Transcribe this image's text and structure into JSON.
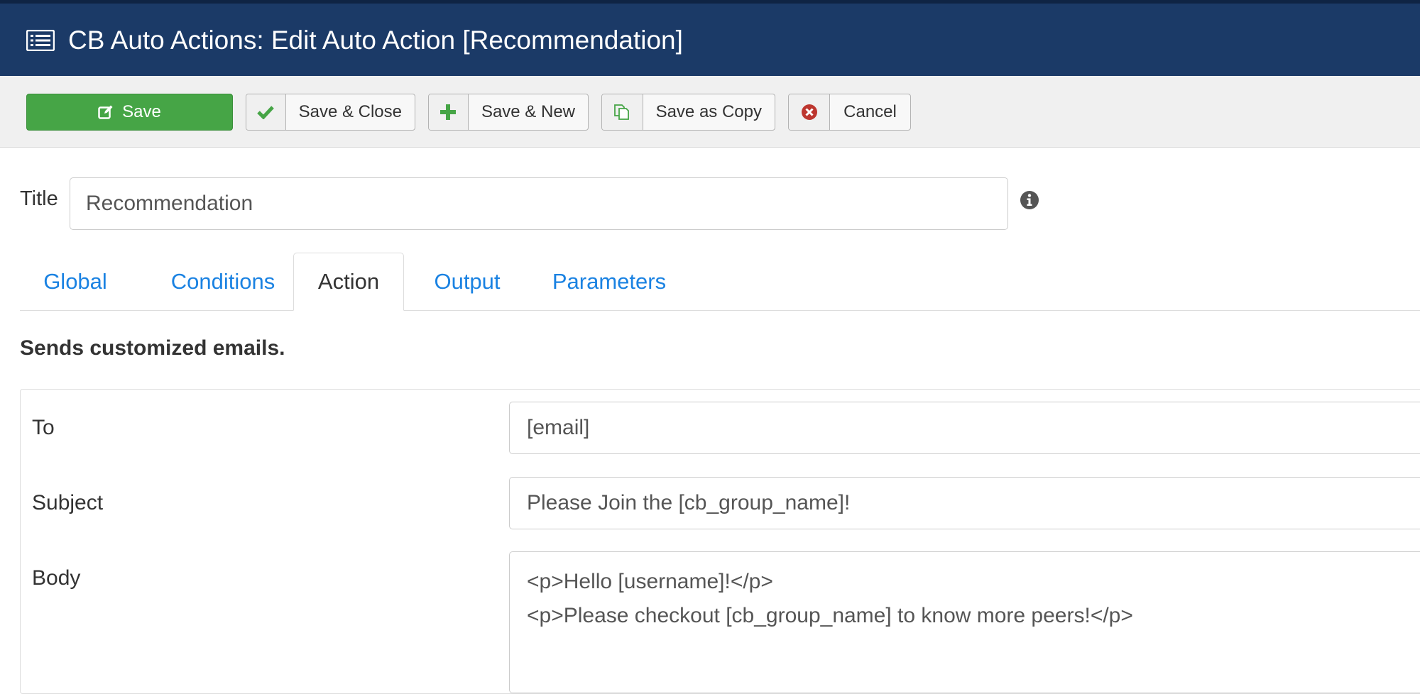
{
  "header": {
    "title": "CB Auto Actions: Edit Auto Action [Recommendation]",
    "icon": "list-icon",
    "background": "#1b3a67"
  },
  "toolbar": {
    "save": {
      "label": "Save",
      "icon": "edit-icon",
      "color": "#46a546"
    },
    "save_close": {
      "label": "Save & Close",
      "icon": "check-icon"
    },
    "save_new": {
      "label": "Save & New",
      "icon": "plus-icon"
    },
    "save_copy": {
      "label": "Save as Copy",
      "icon": "copy-icon"
    },
    "cancel": {
      "label": "Cancel",
      "icon": "cancel-circle-icon"
    }
  },
  "title_field": {
    "label": "Title",
    "value": "Recommendation",
    "info_icon": "info-icon"
  },
  "tabs": [
    {
      "label": "Global",
      "active": false
    },
    {
      "label": "Conditions",
      "active": false
    },
    {
      "label": "Action",
      "active": true
    },
    {
      "label": "Output",
      "active": false
    },
    {
      "label": "Parameters",
      "active": false
    }
  ],
  "description": "Sends customized emails.",
  "fields": {
    "to": {
      "label": "To",
      "value": "[email]"
    },
    "subject": {
      "label": "Subject",
      "value": "Please Join the [cb_group_name]!"
    },
    "body": {
      "label": "Body",
      "value": "<p>Hello [username]!</p>\n<p>Please checkout [cb_group_name] to know more peers!</p>"
    }
  },
  "colors": {
    "link": "#1a82e2",
    "save_green": "#46a546",
    "cancel_red": "#bd362f"
  }
}
